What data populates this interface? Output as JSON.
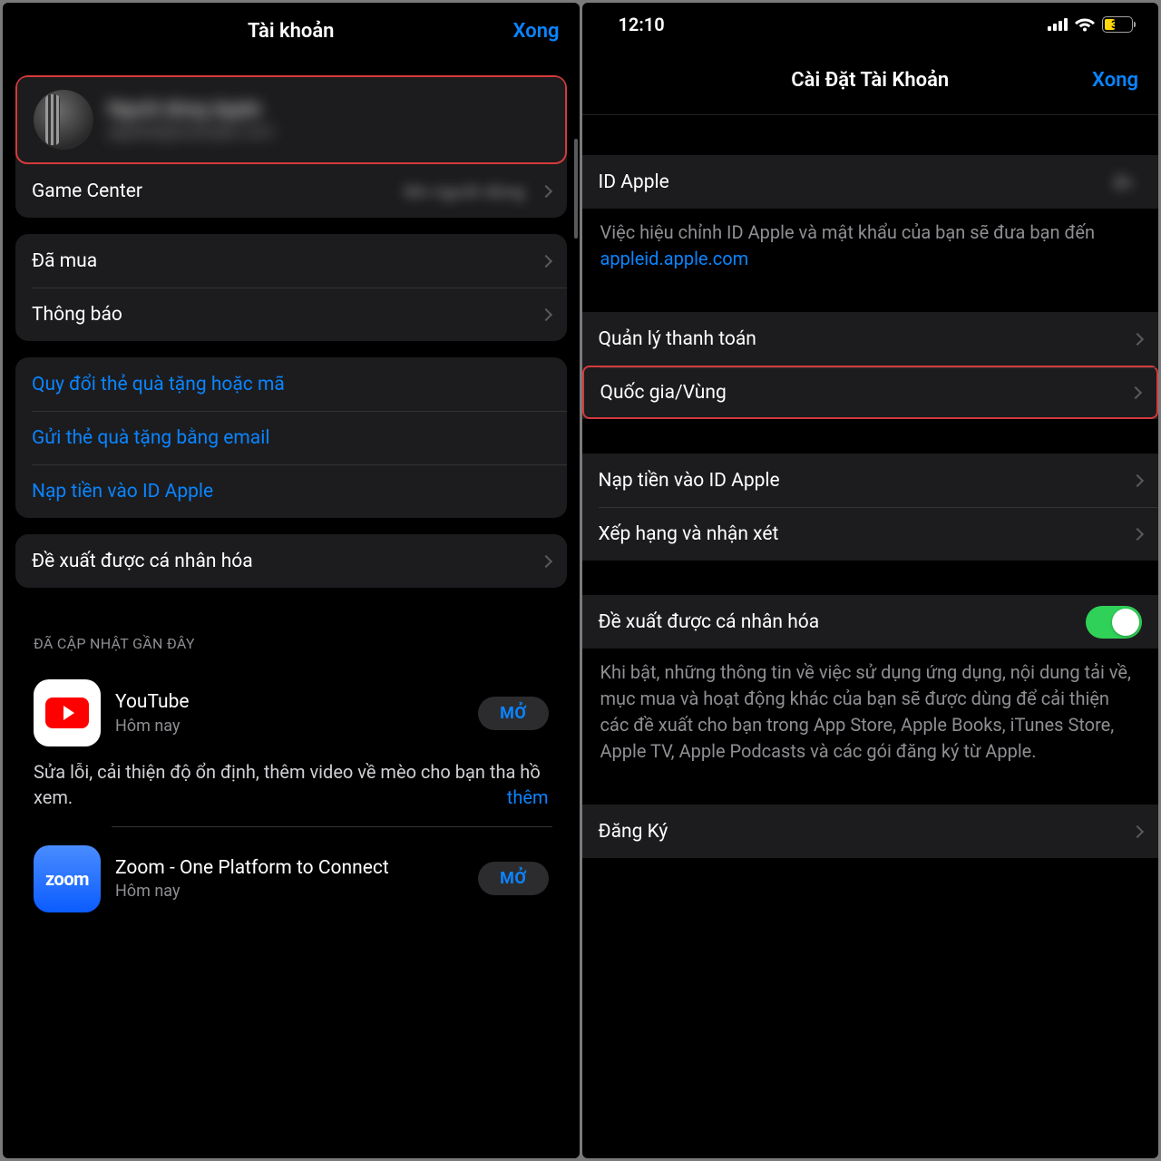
{
  "left": {
    "title": "Tài khoản",
    "done": "Xong",
    "profile_name": "Người dùng Apple",
    "profile_sub": "appleid@example.com",
    "game_center": "Game Center",
    "game_center_value": "tên người dùng",
    "purchased": "Đã mua",
    "notifications": "Thông báo",
    "redeem": "Quy đổi thẻ quà tặng hoặc mã",
    "send_gift": "Gửi thẻ quà tặng bằng email",
    "add_funds": "Nạp tiền vào ID Apple",
    "personalized": "Đề xuất được cá nhân hóa",
    "recent_header": "ĐÃ CẬP NHẬT GẦN ĐÂY",
    "apps": {
      "youtube": {
        "name": "YouTube",
        "subtitle": "Hôm nay",
        "open": "MỞ",
        "desc": "Sửa lỗi, cải thiện độ ổn định, thêm video về mèo cho bạn tha hồ xem.",
        "more": "thêm"
      },
      "zoom": {
        "name": "Zoom - One Platform to Connect",
        "subtitle": "Hôm nay",
        "open": "MỞ",
        "icon_text": "zoom"
      }
    }
  },
  "right": {
    "time": "12:10",
    "battery": "38",
    "title": "Cài Đặt Tài Khoản",
    "done": "Xong",
    "apple_id_label": "ID Apple",
    "apple_id_value": "ẩn",
    "apple_id_footer_pre": "Việc hiệu chỉnh ID Apple và mật khẩu của bạn sẽ đưa bạn đến ",
    "apple_id_footer_link": "appleid.apple.com",
    "manage_payment": "Quản lý thanh toán",
    "country_region": "Quốc gia/Vùng",
    "add_funds": "Nạp tiền vào ID Apple",
    "ratings": "Xếp hạng và nhận xét",
    "personalized": "Đề xuất được cá nhân hóa",
    "personalized_footer": "Khi bật, những thông tin về việc sử dụng ứng dụng, nội dung tải về, mục mua và hoạt động khác của bạn sẽ được dùng để cải thiện các đề xuất cho bạn trong App Store, Apple Books, iTunes Store, Apple TV, Apple Podcasts và các gói đăng ký từ Apple.",
    "subscriptions": "Đăng Ký"
  }
}
